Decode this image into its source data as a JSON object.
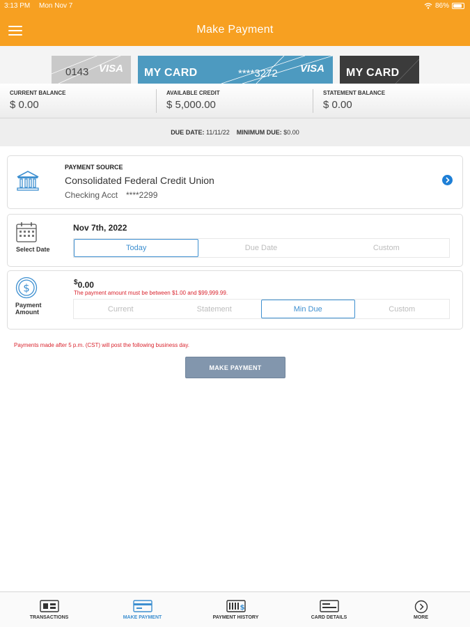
{
  "status_bar": {
    "time": "3:13 PM",
    "date": "Mon Nov 7",
    "battery": "86%",
    "battery_level": 0.86
  },
  "header": {
    "title": "Make Payment"
  },
  "cards": [
    {
      "number": "0143",
      "brand": "VISA",
      "color": "#c9c9c9"
    },
    {
      "name": "MY CARD",
      "number": "****3272",
      "brand": "VISA",
      "color": "#4d9ac0"
    },
    {
      "name": "MY CARD",
      "color": "#3b3b3b"
    }
  ],
  "balances": {
    "current": {
      "label": "CURRENT BALANCE",
      "value": "$ 0.00"
    },
    "available": {
      "label": "AVAILABLE CREDIT",
      "value": "$ 5,000.00"
    },
    "statement": {
      "label": "STATEMENT BALANCE",
      "value": "$ 0.00"
    }
  },
  "due": {
    "date_label": "DUE DATE:",
    "date_value": "11/11/22",
    "min_label": "MINIMUM DUE:",
    "min_value": "$0.00"
  },
  "payment_source": {
    "label": "PAYMENT SOURCE",
    "name": "Consolidated Federal Credit Union",
    "account_type": "Checking Acct",
    "account_number": "****2299"
  },
  "select_date": {
    "label": "Select Date",
    "value": "Nov 7th, 2022",
    "options": [
      "Today",
      "Due Date",
      "Custom"
    ],
    "selected": "Today"
  },
  "payment_amount": {
    "label_line1": "Payment",
    "label_line2": "Amount",
    "currency": "$",
    "value": "0.00",
    "warning": "The payment amount must be between $1.00 and $99,999.99.",
    "options": [
      "Current",
      "Statement",
      "Min Due",
      "Custom"
    ],
    "selected": "Min Due"
  },
  "notice": "Payments made after 5 p.m. (CST) will post the following business day.",
  "make_payment_button": "MAKE PAYMENT",
  "tabs": [
    {
      "label": "TRANSACTIONS",
      "icon": "transactions-icon"
    },
    {
      "label": "MAKE PAYMENT",
      "icon": "make-payment-icon",
      "active": true
    },
    {
      "label": "PAYMENT HISTORY",
      "icon": "payment-history-icon"
    },
    {
      "label": "CARD DETAILS",
      "icon": "card-details-icon"
    },
    {
      "label": "MORE",
      "icon": "more-icon"
    }
  ],
  "colors": {
    "header": "#f7a021",
    "accent": "#3d8fd0",
    "warning": "#d9232d",
    "button": "#8296ad"
  }
}
